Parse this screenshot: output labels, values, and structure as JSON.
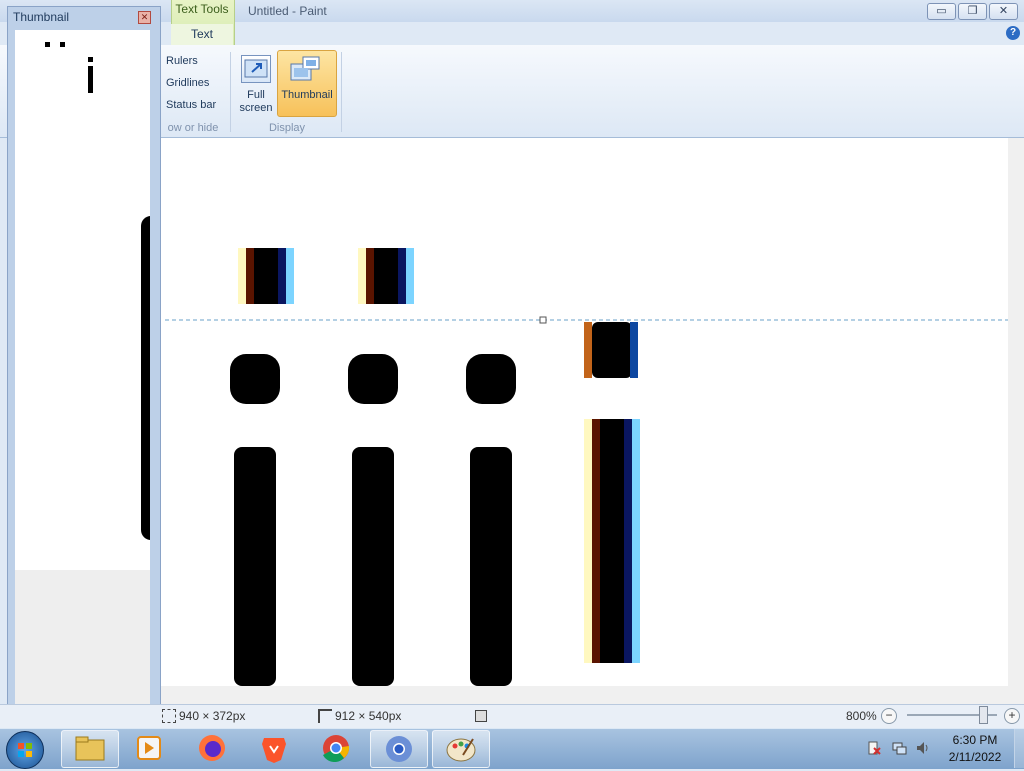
{
  "window": {
    "title": "Untitled - Paint",
    "context_tab_group": "Text Tools",
    "context_tab": "Text",
    "minimize_glyph": "▭",
    "maximize_glyph": "❐",
    "close_glyph": "✕",
    "help_glyph": "?"
  },
  "ribbon": {
    "show_or_hide": {
      "rulers": "Rulers",
      "gridlines": "Gridlines",
      "status_bar": "Status bar",
      "group_label": "ow or hide"
    },
    "display": {
      "full_screen": "Full\nscreen",
      "full_screen_line1": "Full",
      "full_screen_line2": "screen",
      "thumbnail": "Thumbnail",
      "group_label": "Display"
    }
  },
  "thumbnail_window": {
    "title": "Thumbnail",
    "close_glyph": "✕",
    "preview_glyph": "i"
  },
  "statusbar": {
    "selection_size": "940 × 372px",
    "canvas_size": "912 × 540px",
    "zoom": "800%",
    "zoom_out": "−",
    "zoom_in": "+",
    "zoom_level_fraction": 0.85
  },
  "taskbar": {
    "apps": [
      "start-orb",
      "file-explorer",
      "media-player",
      "firefox",
      "brave",
      "chrome",
      "chrome-canary",
      "paint"
    ],
    "time": "6:30 PM",
    "date": "2/11/2022"
  },
  "colors": {
    "ribbon_bg": "#dde8f5",
    "context_green": "#d6ebb0",
    "active_button": "#f7c15a",
    "canvas": "#ffffff",
    "glyph": "#000000"
  }
}
